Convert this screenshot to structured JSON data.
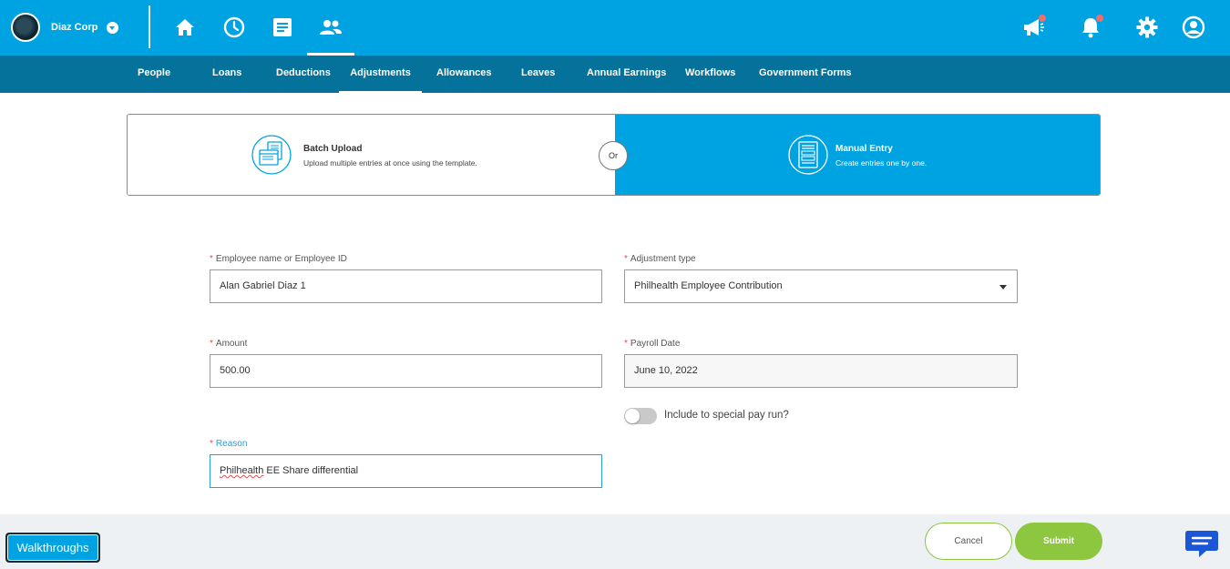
{
  "header": {
    "company_name": "Diaz Corp",
    "nav_icons": [
      "home-icon",
      "clock-icon",
      "document-icon",
      "people-icon"
    ],
    "active_nav": "people-icon",
    "right_icons": [
      "megaphone-icon",
      "bell-icon",
      "gear-icon",
      "user-account-icon"
    ],
    "brand_color": "#00a3e1",
    "badge_color": "#f26d6d"
  },
  "subnav": {
    "items": [
      {
        "label": "People"
      },
      {
        "label": "Loans"
      },
      {
        "label": "Deductions"
      },
      {
        "label": "Adjustments"
      },
      {
        "label": "Allowances"
      },
      {
        "label": "Leaves"
      },
      {
        "label": "Annual Earnings"
      },
      {
        "label": "Workflows"
      },
      {
        "label": "Government Forms"
      }
    ],
    "active": "Adjustments",
    "bg_color": "#04729a"
  },
  "mode": {
    "or_label": "Or",
    "selected": "Manual Entry",
    "batch": {
      "title": "Batch Upload",
      "description": "Upload multiple entries at once using the template."
    },
    "manual": {
      "title": "Manual Entry",
      "description": "Create entries one by one."
    }
  },
  "form": {
    "required_marker": "*",
    "employee": {
      "label": "Employee name or Employee ID",
      "value": "Alan Gabriel Diaz 1"
    },
    "adjustment_type": {
      "label": "Adjustment type",
      "value": "Philhealth Employee Contribution"
    },
    "amount": {
      "label": "Amount",
      "value": "500.00"
    },
    "payroll_date": {
      "label": "Payroll Date",
      "value": "June 10, 2022"
    },
    "special_pay_run": {
      "label": "Include to special pay run?",
      "checked": false
    },
    "reason": {
      "label": "Reason",
      "value_misspelled": "Philhealth",
      "value_rest": " EE Share differential"
    }
  },
  "footer": {
    "walkthroughs_label": "Walkthroughs",
    "cancel_label": "Cancel",
    "submit_label": "Submit",
    "submit_color": "#8dc63f",
    "chat_icon": "chat-bubble-icon"
  }
}
